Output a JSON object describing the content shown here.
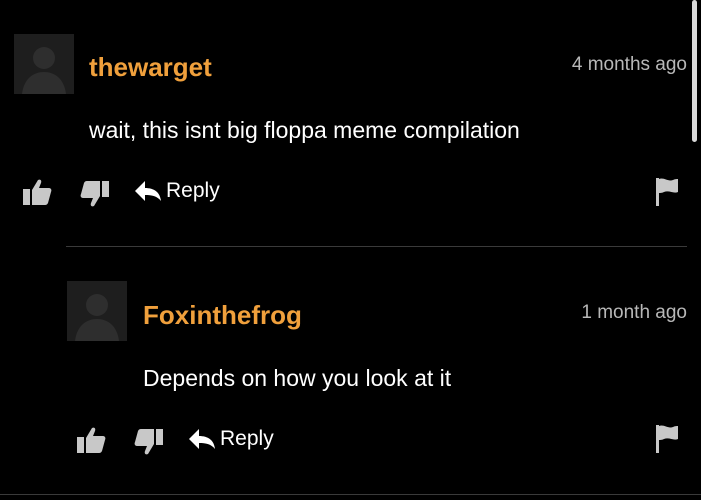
{
  "comments": [
    {
      "username": "thewarget",
      "timestamp": "4 months ago",
      "text": "wait, this isnt big floppa meme compilation",
      "reply_label": "Reply"
    },
    {
      "username": "Foxinthefrog",
      "timestamp": "1 month ago",
      "text": "Depends on how you look at it",
      "reply_label": "Reply"
    }
  ],
  "colors": {
    "background": "#000000",
    "username": "#f0a03c",
    "text": "#ffffff",
    "timestamp": "#b8b8b8",
    "icon": "#c8c8c8"
  },
  "icons": [
    "avatar-placeholder-icon",
    "thumbs-up-icon",
    "thumbs-down-icon",
    "reply-arrow-icon",
    "flag-icon"
  ]
}
